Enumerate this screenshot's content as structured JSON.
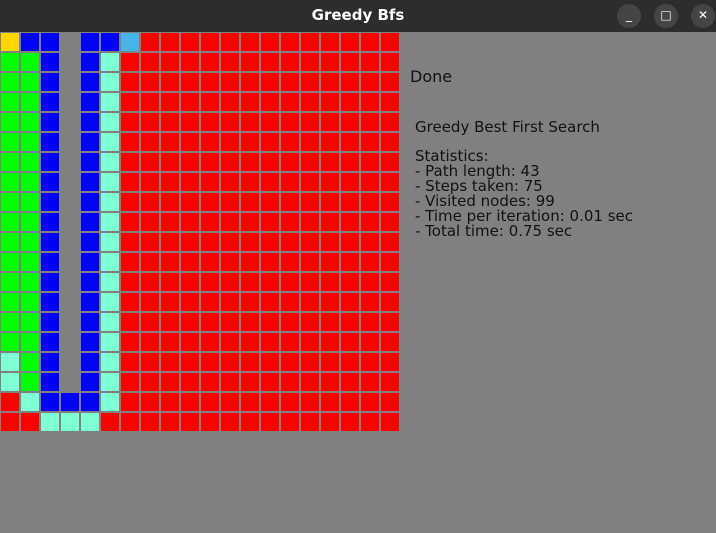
{
  "window": {
    "title": "Greedy Bfs",
    "minimize_glyph": "_",
    "maximize_glyph": "□",
    "close_glyph": "✕"
  },
  "grid": {
    "legend": {
      "R": "#ff0000",
      "G": "#00ff00",
      "B": "#0000ff",
      "C": "#7fffd4",
      "Y": "#ffd700",
      "S": "#47b3e8",
      "W": "#808080"
    },
    "rows": [
      "YBBWBBSRRRRRRRRRRRRR",
      "GGBWBCRRRRRRRRRRRRRR",
      "GGBWBCRRRRRRRRRRRRRR",
      "GGBWBCRRRRRRRRRRRRRR",
      "GGBWBCRRRRRRRRRRRRRR",
      "GGBWBCRRRRRRRRRRRRRR",
      "GGBWBCRRRRRRRRRRRRRR",
      "GGBWBCRRRRRRRRRRRRRR",
      "GGBWBCRRRRRRRRRRRRRR",
      "GGBWBCRRRRRRRRRRRRRR",
      "GGBWBCRRRRRRRRRRRRRR",
      "GGBWBCRRRRRRRRRRRRRR",
      "GGBWBCRRRRRRRRRRRRRR",
      "GGBWBCRRRRRRRRRRRRRR",
      "GGBWBCRRRRRRRRRRRRRR",
      "GGBWBCRRRRRRRRRRRRRR",
      "CGBWBCRRRRRRRRRRRRRR",
      "CGBWBCRRRRRRRRRRRRRR",
      "RCBBBCRRRRRRRRRRRRRR",
      "RRCCCRRRRRRRRRRRRRRR"
    ]
  },
  "status": "Done",
  "algorithm": "Greedy Best First Search",
  "statistics": {
    "heading": "Statistics:",
    "lines": [
      "- Path length: 43",
      "- Steps taken: 75",
      "- Visited nodes: 99",
      "- Time per iteration: 0.01 sec",
      "- Total time: 0.75 sec"
    ]
  }
}
